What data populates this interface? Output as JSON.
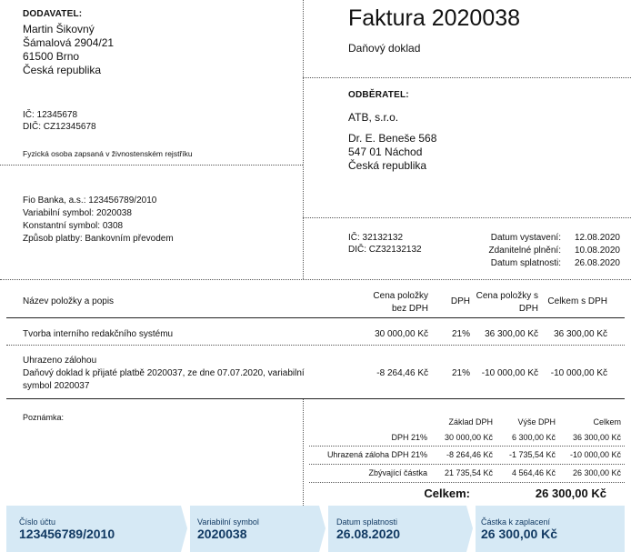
{
  "supplier": {
    "label": "DODAVATEL:",
    "name": "Martin Šikovný",
    "street": "Šámalová 2904/21",
    "city": "61500 Brno",
    "country": "Česká republika",
    "ic": "IČ: 12345678",
    "dic": "DIČ: CZ12345678",
    "registration_note": "Fyzická osoba zapsaná v živnostenském rejstříku"
  },
  "payment": {
    "bank": "Fio Banka, a.s.: 123456789/2010",
    "variable_symbol": "Variabilní symbol: 2020038",
    "constant_symbol": "Konstantní symbol: 0308",
    "method": "Způsob platby: Bankovním převodem"
  },
  "invoice": {
    "title": "Faktura 2020038",
    "subtitle": "Daňový doklad"
  },
  "customer": {
    "label": "ODBĚRATEL:",
    "name": "ATB, s.r.o.",
    "street": "Dr. E. Beneše 568",
    "city": "547 01 Náchod",
    "country": "Česká republika",
    "ic": "IČ: 32132132",
    "dic": "DIČ: CZ32132132"
  },
  "dates": {
    "issued_label": "Datum vystavení:",
    "issued_value": "12.08.2020",
    "taxable_label": "Zdanitelné plnění:",
    "taxable_value": "10.08.2020",
    "due_label": "Datum splatnosti:",
    "due_value": "26.08.2020"
  },
  "items_table": {
    "headers": {
      "name": "Název položky a popis",
      "price_ex": "Cena položky bez DPH",
      "vat": "DPH",
      "price_inc": "Cena položky s DPH",
      "total_inc": "Celkem s DPH"
    },
    "rows": [
      {
        "name": "Tvorba interního redakčního systému",
        "detail": "",
        "price_ex": "30 000,00 Kč",
        "vat": "21%",
        "price_inc": "36 300,00 Kč",
        "total_inc": "36 300,00 Kč"
      },
      {
        "name": "Uhrazeno zálohou",
        "detail": "Daňový doklad k přijaté platbě 2020037, ze dne 07.07.2020, variabilní symbol 2020037",
        "price_ex": "-8 264,46 Kč",
        "vat": "21%",
        "price_inc": "-10 000,00 Kč",
        "total_inc": "-10 000,00 Kč"
      }
    ]
  },
  "note_label": "Poznámka:",
  "summary": {
    "headers": {
      "base": "Základ DPH",
      "vat": "Výše DPH",
      "total": "Celkem"
    },
    "rows": [
      {
        "label": "DPH 21%",
        "base": "30 000,00 Kč",
        "vat": "6 300,00 Kč",
        "total": "36 300,00 Kč"
      },
      {
        "label": "Uhrazená záloha DPH 21%",
        "base": "-8 264,46 Kč",
        "vat": "-1 735,54 Kč",
        "total": "-10 000,00 Kč"
      },
      {
        "label": "Zbývající částka",
        "base": "21 735,54 Kč",
        "vat": "4 564,46 Kč",
        "total": "26 300,00 Kč"
      }
    ],
    "grand_label": "Celkem:",
    "grand_value": "26 300,00 Kč"
  },
  "footer": {
    "account_label": "Číslo účtu",
    "account_value": "123456789/2010",
    "vs_label": "Variabilní symbol",
    "vs_value": "2020038",
    "due_label": "Datum splatnosti",
    "due_value": "26.08.2020",
    "amount_label": "Částka k zaplacení",
    "amount_value": "26 300,00 Kč"
  },
  "colors": {
    "footer_bg": "#d6e9f5",
    "footer_text": "#123a63"
  }
}
